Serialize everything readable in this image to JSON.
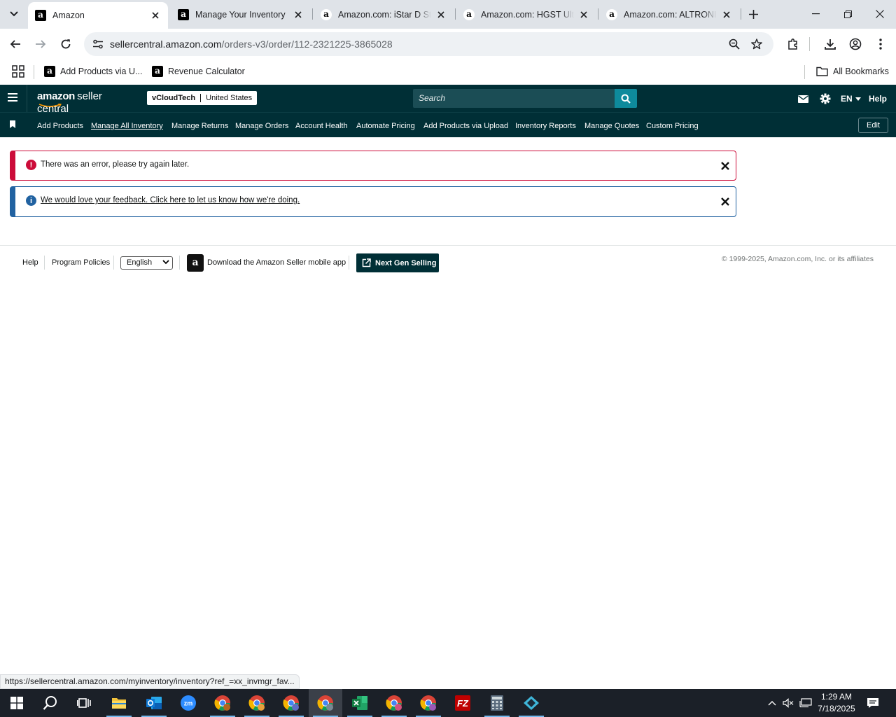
{
  "browser": {
    "tabs": [
      {
        "title": "Amazon",
        "active": true
      },
      {
        "title": "Manage Your Inventory",
        "active": false
      },
      {
        "title": "Amazon.com: iStar D Storage",
        "active": false
      },
      {
        "title": "Amazon.com: HGST Ultrastar",
        "active": false
      },
      {
        "title": "Amazon.com: ALTRONIX",
        "active": false
      }
    ],
    "url_host": "sellercentral.amazon.com",
    "url_path": "/orders-v3/order/112-2321225-3865028",
    "bookmarks": [
      {
        "label": "Add Products via U..."
      },
      {
        "label": "Revenue Calculator"
      }
    ],
    "all_bookmarks_label": "All Bookmarks",
    "status_url": "https://sellercentral.amazon.com/myinventory/inventory?ref_=xx_invmgr_fav..."
  },
  "header": {
    "logo_bold": "amazon",
    "logo_rest": "seller central",
    "account_name": "vCloudTech",
    "account_country": "United States",
    "search_placeholder": "Search",
    "language": "EN",
    "help_label": "Help"
  },
  "nav": {
    "items": [
      {
        "label": "Add Products"
      },
      {
        "label": "Manage All Inventory"
      },
      {
        "label": "Manage Returns"
      },
      {
        "label": "Manage Orders"
      },
      {
        "label": "Account Health"
      },
      {
        "label": "Automate Pricing"
      },
      {
        "label": "Add Products via Upload"
      },
      {
        "label": "Inventory Reports"
      },
      {
        "label": "Manage Quotes"
      },
      {
        "label": "Custom Pricing"
      }
    ],
    "edit_label": "Edit"
  },
  "alerts": {
    "error_text": "There was an error, please try again later.",
    "info_text": "We would love your feedback. Click here to let us know how we're doing."
  },
  "footer": {
    "help": "Help",
    "program_policies": "Program Policies",
    "language_selected": "English",
    "app_download": "Download the Amazon Seller mobile app",
    "next_gen": "Next Gen Selling",
    "copyright": "© 1999-2025, Amazon.com, Inc. or its affiliates"
  },
  "taskbar": {
    "time": "1:29 AM",
    "date": "7/18/2025"
  },
  "colors": {
    "header_bg": "#002f36",
    "search_button": "#0e8a9c",
    "error": "#cc0c39",
    "info": "#2162a1",
    "taskbar_bg": "#1b2028"
  }
}
